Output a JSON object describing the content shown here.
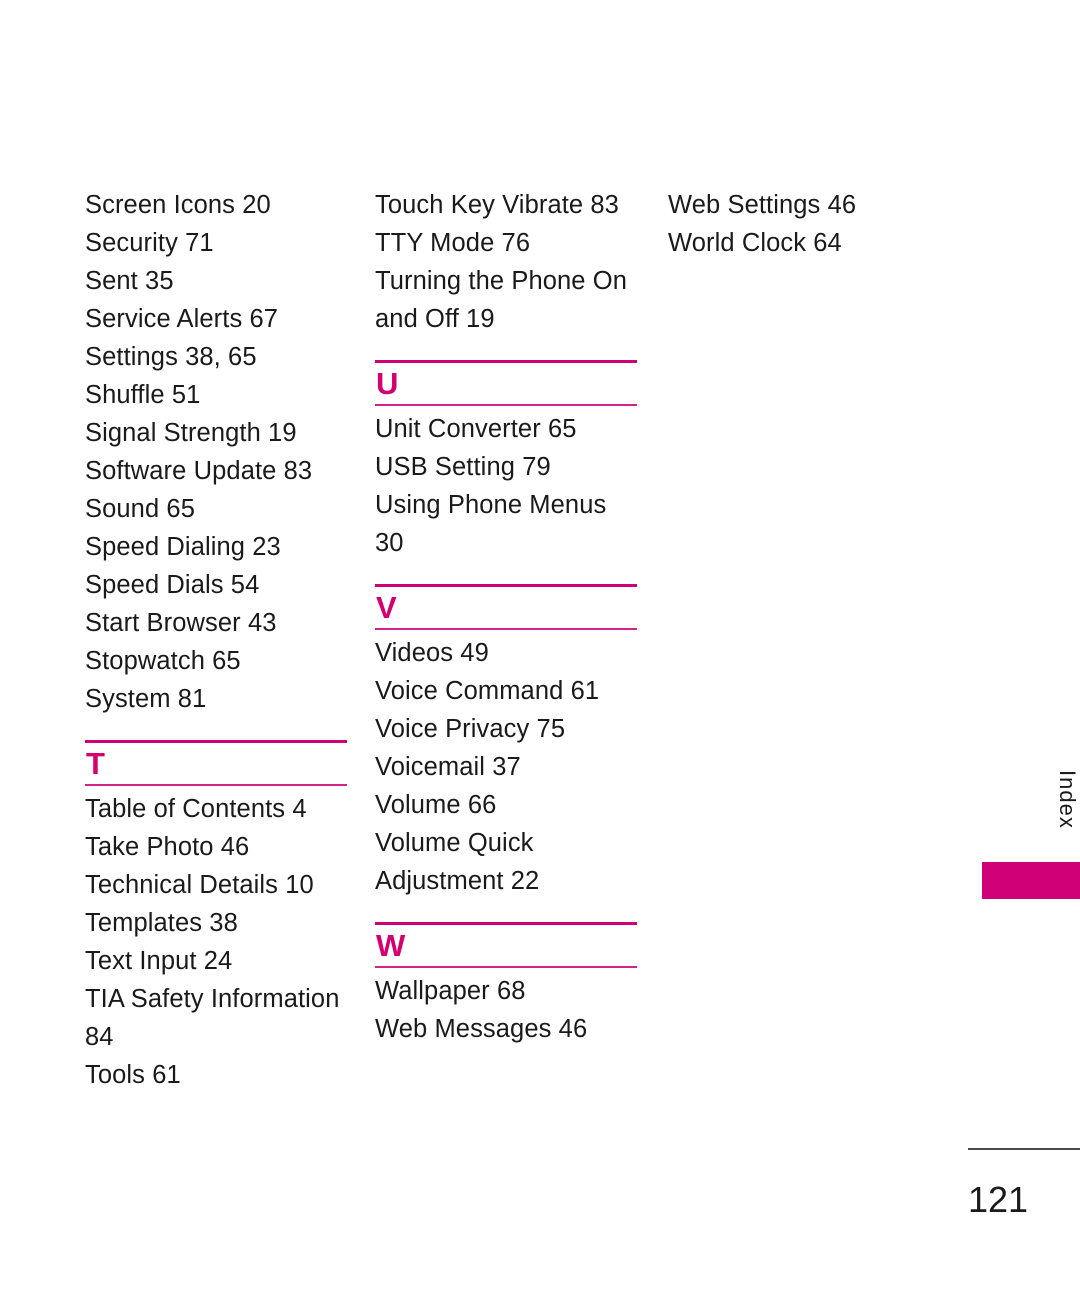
{
  "page": {
    "number": "121",
    "side_tab_label": "Index",
    "accent_color": "#cf0077",
    "letter_color": "#d4006f",
    "text_color": "#1a1a1a",
    "footer_rule_color": "#4a4a4a"
  },
  "columns": [
    {
      "id": "column-1",
      "blocks": [
        {
          "type": "entries",
          "entries": [
            "Screen Icons 20",
            "Security 71",
            "Sent 35",
            "Service Alerts 67",
            "Settings 38, 65",
            "Shuffle 51",
            "Signal Strength 19",
            "Software Update 83",
            "Sound 65",
            "Speed Dialing 23",
            "Speed Dials 54",
            "Start Browser 43",
            "Stopwatch 65",
            "System 81"
          ]
        },
        {
          "type": "letter",
          "letter": "T"
        },
        {
          "type": "entries",
          "entries": [
            "Table of Contents 4",
            "Take Photo 46",
            "Technical Details 10",
            "Templates 38",
            "Text Input 24",
            "TIA Safety Information\n84",
            "Tools 61"
          ]
        }
      ]
    },
    {
      "id": "column-2",
      "blocks": [
        {
          "type": "entries",
          "entries": [
            "Touch Key Vibrate 83",
            "TTY Mode 76",
            "Turning the Phone On\nand Off 19"
          ]
        },
        {
          "type": "letter",
          "letter": "U"
        },
        {
          "type": "entries",
          "entries": [
            "Unit Converter 65",
            "USB Setting 79",
            "Using Phone Menus\n30"
          ]
        },
        {
          "type": "letter",
          "letter": "V"
        },
        {
          "type": "entries",
          "entries": [
            "Videos 49",
            "Voice Command 61",
            "Voice Privacy 75",
            "Voicemail 37",
            "Volume 66",
            "Volume Quick\nAdjustment 22"
          ]
        },
        {
          "type": "letter",
          "letter": "W"
        },
        {
          "type": "entries",
          "entries": [
            "Wallpaper 68",
            "Web Messages 46"
          ]
        }
      ]
    },
    {
      "id": "column-3",
      "blocks": [
        {
          "type": "entries",
          "entries": [
            "Web Settings 46",
            "World Clock 64"
          ]
        }
      ]
    }
  ]
}
